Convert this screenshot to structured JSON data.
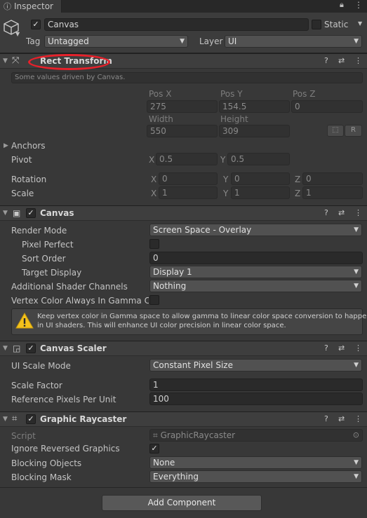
{
  "window": {
    "tab_label": "Inspector"
  },
  "object": {
    "name": "Canvas",
    "static_label": "Static",
    "tag_label": "Tag",
    "tag_value": "Untagged",
    "layer_label": "Layer",
    "layer_value": "UI"
  },
  "rect_transform": {
    "title": "Rect Transform",
    "driven_note": "Some values driven by Canvas.",
    "pos_x_label": "Pos X",
    "pos_y_label": "Pos Y",
    "pos_z_label": "Pos Z",
    "pos_x": "275",
    "pos_y": "154.5",
    "pos_z": "0",
    "width_label": "Width",
    "height_label": "Height",
    "width": "550",
    "height": "309",
    "raw_button": "R",
    "anchors_label": "Anchors",
    "pivot_label": "Pivot",
    "pivot_x": "0.5",
    "pivot_y": "0.5",
    "rotation_label": "Rotation",
    "rot_x": "0",
    "rot_y": "0",
    "rot_z": "0",
    "scale_label": "Scale",
    "scale_x": "1",
    "scale_y": "1",
    "scale_z": "1",
    "x": "X",
    "y": "Y",
    "z": "Z"
  },
  "canvas": {
    "title": "Canvas",
    "render_mode_label": "Render Mode",
    "render_mode_value": "Screen Space - Overlay",
    "pixel_perfect_label": "Pixel Perfect",
    "sort_order_label": "Sort Order",
    "sort_order_value": "0",
    "target_display_label": "Target Display",
    "target_display_value": "Display 1",
    "shader_channels_label": "Additional Shader Channels",
    "shader_channels_value": "Nothing",
    "vertex_color_label": "Vertex Color Always In Gamma Col",
    "warning_line1": "Keep vertex color in Gamma space to allow gamma to linear color space conversion to happen",
    "warning_line2": "in UI shaders. This will enhance UI color precision in linear color space."
  },
  "canvas_scaler": {
    "title": "Canvas Scaler",
    "ui_scale_mode_label": "UI Scale Mode",
    "ui_scale_mode_value": "Constant Pixel Size",
    "scale_factor_label": "Scale Factor",
    "scale_factor_value": "1",
    "ref_ppu_label": "Reference Pixels Per Unit",
    "ref_ppu_value": "100"
  },
  "graphic_raycaster": {
    "title": "Graphic Raycaster",
    "script_label": "Script",
    "script_value": "GraphicRaycaster",
    "ignore_reversed_label": "Ignore Reversed Graphics",
    "blocking_objects_label": "Blocking Objects",
    "blocking_objects_value": "None",
    "blocking_mask_label": "Blocking Mask",
    "blocking_mask_value": "Everything"
  },
  "add_component_label": "Add Component",
  "colors": {
    "annotation_circle": "#e8202a"
  }
}
